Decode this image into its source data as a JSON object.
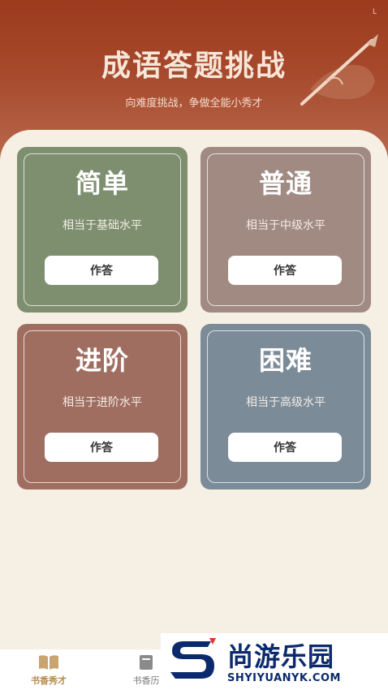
{
  "header": {
    "status_mark": "L",
    "title": "成语答题挑战",
    "subtitle": "向难度挑战，争做全能小秀才"
  },
  "levels": [
    {
      "name": "简单",
      "desc": "相当于基础水平",
      "button": "作答",
      "color": "#7e8f6f"
    },
    {
      "name": "普通",
      "desc": "相当于中级水平",
      "button": "作答",
      "color": "#a08a82"
    },
    {
      "name": "进阶",
      "desc": "相当于进阶水平",
      "button": "作答",
      "color": "#a06e60"
    },
    {
      "name": "困难",
      "desc": "相当于高级水平",
      "button": "作答",
      "color": "#7b8b98"
    }
  ],
  "tabbar": {
    "items": [
      {
        "label": "书香秀才",
        "icon": "book-open-icon",
        "active": true
      },
      {
        "label": "书香历",
        "icon": "book-icon",
        "active": false
      }
    ]
  },
  "watermark": {
    "cn": "尚游乐园",
    "en": "SHYIYUANYK.COM",
    "icon": "s-logo-icon"
  },
  "colors": {
    "header": "#9b3a1e",
    "background": "#f6efe4",
    "active_tab": "#b58a4c",
    "watermark": "#0b2a6e",
    "watermark_accent": "#e0342f"
  }
}
